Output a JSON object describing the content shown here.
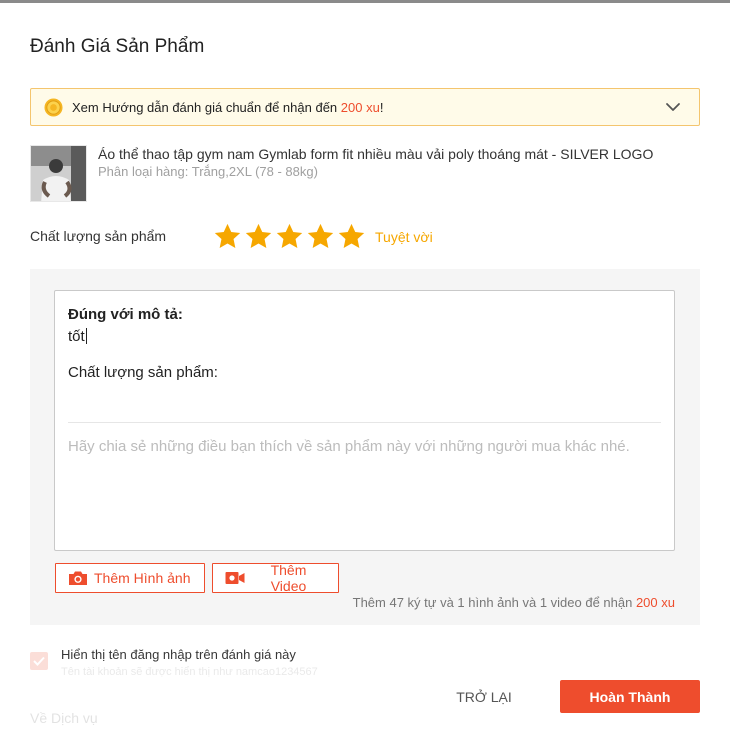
{
  "dialog": {
    "title": "Đánh Giá Sản Phẩm"
  },
  "banner": {
    "text_before": "Xem Hướng dẫn đánh giá chuẩn để nhận đến ",
    "highlight": "200 xu",
    "text_after": "!",
    "icon": "coin-icon",
    "expand_icon": "chevron-down-icon"
  },
  "product": {
    "name": "Áo thể thao tập gym nam Gymlab form fit nhiều màu vải poly thoáng mát - SILVER LOGO",
    "variation": "Phân loại hàng: Trắng,2XL (78 - 88kg)"
  },
  "rating": {
    "label": "Chất lượng sản phẩm",
    "stars": 5,
    "max_stars": 5,
    "text": "Tuyệt vời"
  },
  "editor": {
    "field1_label": "Đúng với mô tả:",
    "field1_value": "tốt",
    "field2_label": "Chất lượng sản phẩm:",
    "placeholder": "Hãy chia sẻ những điều bạn thích về sản phẩm này với những người mua khác nhé."
  },
  "media": {
    "photo_label": "Thêm Hình ảnh",
    "video_label": "Thêm Video",
    "photo_icon": "camera-icon",
    "video_icon": "video-camera-icon"
  },
  "hint": {
    "text": "Thêm 47 ký tự và 1 hình ảnh và 1 video để nhận ",
    "highlight": "200 xu"
  },
  "username": {
    "label": "Hiển thị tên đăng nhập trên đánh giá này",
    "sub": "Tên tài khoản sẽ được hiển thị như namcao1234567",
    "checked": true
  },
  "service": {
    "label": "Về Dịch vụ"
  },
  "footer": {
    "back_label": "TRỞ LẠI",
    "submit_label": "Hoàn Thành"
  },
  "colors": {
    "accent": "#ee4d2d",
    "star": "#f6a700",
    "banner_bg": "#fffbe9",
    "banner_border": "#f4c56e"
  }
}
